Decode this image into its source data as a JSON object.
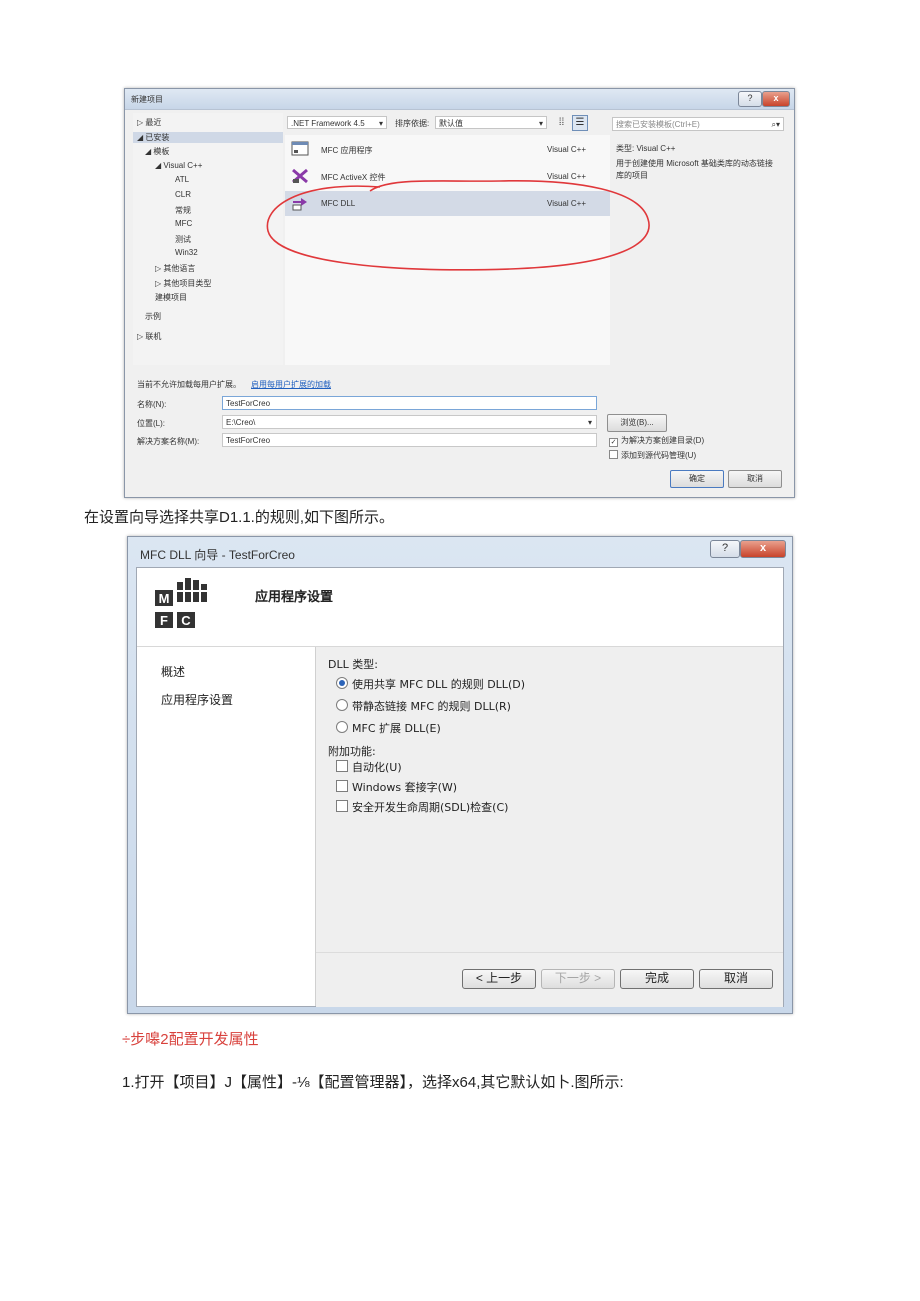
{
  "dialog1": {
    "title": "新建项目",
    "tree": [
      {
        "label": "▷ 最近",
        "indent": 0
      },
      {
        "label": "◢ 已安装",
        "indent": 0,
        "selected": true
      },
      {
        "label": "◢ 模板",
        "indent": 1
      },
      {
        "label": "◢ Visual C++",
        "indent": 2
      },
      {
        "label": "ATL",
        "indent": 3
      },
      {
        "label": "CLR",
        "indent": 3
      },
      {
        "label": "常规",
        "indent": 3
      },
      {
        "label": "MFC",
        "indent": 3
      },
      {
        "label": "测试",
        "indent": 3
      },
      {
        "label": "Win32",
        "indent": 3
      },
      {
        "label": "▷ 其他语言",
        "indent": 2
      },
      {
        "label": "▷ 其他项目类型",
        "indent": 2
      },
      {
        "label": "建模项目",
        "indent": 2
      },
      {
        "label": "示例",
        "indent": 1
      },
      {
        "label": "▷ 联机",
        "indent": 0
      }
    ],
    "framework": ".NET Framework 4.5",
    "sort_label": "排序依据:",
    "sort_value": "默认值",
    "search_placeholder": "搜索已安装模板(Ctrl+E)",
    "templates": [
      {
        "name": "MFC 应用程序",
        "lang": "Visual C++"
      },
      {
        "name": "MFC ActiveX 控件",
        "lang": "Visual C++"
      },
      {
        "name": "MFC DLL",
        "lang": "Visual C++",
        "selected": true
      }
    ],
    "type_line": "类型:  Visual C++",
    "description": "用于创建使用 Microsoft 基础类库的动态链接库的项目",
    "notice": "当前不允许加载每用户扩展。",
    "notice_link": "启用每用户扩展的加载",
    "name_label": "名称(N):",
    "name_value": "TestForCreo",
    "location_label": "位置(L):",
    "location_value": "E:\\Creo\\",
    "solution_label": "解决方案名称(M):",
    "solution_value": "TestForCreo",
    "browse": "浏览(B)...",
    "chk_dir": "为解决方案创建目录(D)",
    "chk_scm": "添加到源代码管理(U)",
    "ok": "确定",
    "cancel": "取消",
    "help_btn": "?",
    "close_btn": "x"
  },
  "caption1": "在设置向导选择共享D1.1.的规则,如下图所示。",
  "dialog2": {
    "title": "MFC DLL 向导 - TestForCreo",
    "help_btn": "?",
    "close_btn": "x",
    "logo_row1": "M",
    "logo_row2a": "F",
    "logo_row2b": "C",
    "header_title": "应用程序设置",
    "nav": [
      "概述",
      "应用程序设置"
    ],
    "dll_type_label": "DLL 类型:",
    "dll_options": [
      {
        "label": "使用共享 MFC DLL 的规则 DLL(D)",
        "checked": true
      },
      {
        "label": "带静态链接 MFC 的规则 DLL(R)",
        "checked": false
      },
      {
        "label": "MFC 扩展 DLL(E)",
        "checked": false
      }
    ],
    "extra_label": "附加功能:",
    "extra_options": [
      "自动化(U)",
      "Windows 套接字(W)",
      "安全开发生命周期(SDL)检查(C)"
    ],
    "btn_prev": "< 上一步",
    "btn_next": "下一步 >",
    "btn_finish": "完成",
    "btn_cancel": "取消"
  },
  "step_title": "÷步嗥2配置开发属性",
  "step_text": "1.打开【项目】J【属性】-⅛【配置管理器】，选择x64,其它默认如卜.图所示:",
  "colors": {
    "annotation": "#e0383b",
    "step_title": "#d8413c",
    "link": "#1f5fbf"
  }
}
